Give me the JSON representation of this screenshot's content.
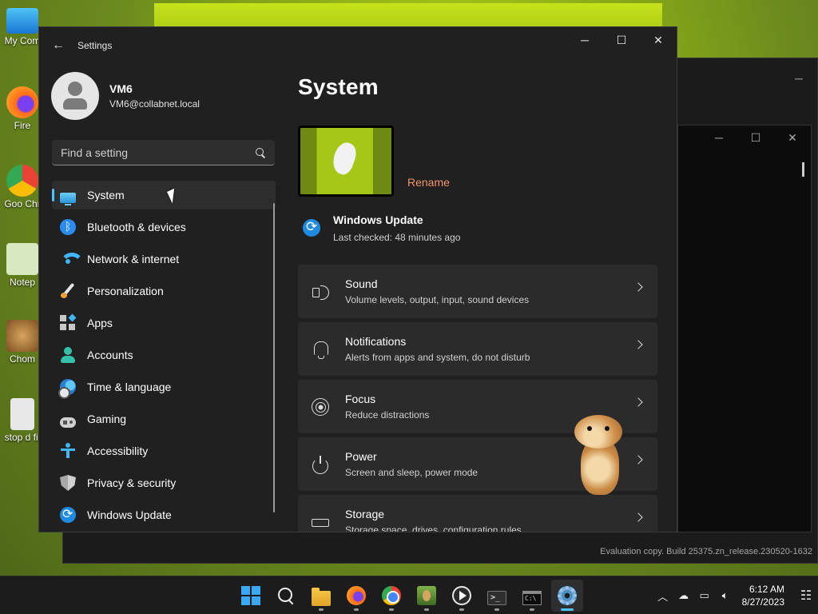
{
  "desktop": {
    "icons": [
      {
        "label": "My Com",
        "icon": "monitor-icon"
      },
      {
        "label": "Fire",
        "icon": "firefox-icon"
      },
      {
        "label": "Goo Chr",
        "icon": "chrome-icon"
      },
      {
        "label": "Notep",
        "icon": "notepad-icon"
      },
      {
        "label": "Chom",
        "icon": "hamster-icon"
      },
      {
        "label": "stop d fil",
        "icon": "file-icon"
      }
    ],
    "build_watermark": "Evaluation copy. Build 25375.zn_release.230520-1632"
  },
  "settings": {
    "app_title": "Settings",
    "back_icon": "back-arrow-icon",
    "window_controls": {
      "minimize": "─",
      "maximize": "☐",
      "close": "✕"
    },
    "profile": {
      "name": "VM6",
      "email": "VM6@collabnet.local"
    },
    "search": {
      "placeholder": "Find a setting"
    },
    "nav": [
      {
        "label": "System",
        "icon": "system-icon",
        "active": true
      },
      {
        "label": "Bluetooth & devices",
        "icon": "bluetooth-icon"
      },
      {
        "label": "Network & internet",
        "icon": "wifi-icon"
      },
      {
        "label": "Personalization",
        "icon": "brush-icon"
      },
      {
        "label": "Apps",
        "icon": "apps-icon"
      },
      {
        "label": "Accounts",
        "icon": "account-icon"
      },
      {
        "label": "Time & language",
        "icon": "clock-globe-icon"
      },
      {
        "label": "Gaming",
        "icon": "gamepad-icon"
      },
      {
        "label": "Accessibility",
        "icon": "accessibility-icon"
      },
      {
        "label": "Privacy & security",
        "icon": "shield-icon"
      },
      {
        "label": "Windows Update",
        "icon": "windows-update-icon"
      }
    ],
    "main": {
      "title": "System",
      "rename_label": "Rename",
      "update": {
        "title": "Windows Update",
        "subtitle": "Last checked: 48 minutes ago"
      },
      "cards": [
        {
          "title": "Sound",
          "desc": "Volume levels, output, input, sound devices",
          "icon": "speaker-icon"
        },
        {
          "title": "Notifications",
          "desc": "Alerts from apps and system, do not disturb",
          "icon": "bell-icon"
        },
        {
          "title": "Focus",
          "desc": "Reduce distractions",
          "icon": "focus-icon"
        },
        {
          "title": "Power",
          "desc": "Screen and sleep, power mode",
          "icon": "power-icon"
        },
        {
          "title": "Storage",
          "desc": "Storage space, drives, configuration rules",
          "icon": "storage-icon"
        }
      ]
    }
  },
  "taskbar": {
    "apps": [
      {
        "name": "Start",
        "icon": "windows-start-icon"
      },
      {
        "name": "Search",
        "icon": "search-icon"
      },
      {
        "name": "File Explorer",
        "icon": "folder-icon",
        "running": true
      },
      {
        "name": "Firefox",
        "icon": "firefox-icon",
        "running": true
      },
      {
        "name": "Google Chrome",
        "icon": "chrome-icon",
        "running": true
      },
      {
        "name": "Game",
        "icon": "game-icon",
        "running": true
      },
      {
        "name": "Media Player",
        "icon": "media-player-icon",
        "running": true
      },
      {
        "name": "Terminal",
        "icon": "terminal-icon",
        "running": true
      },
      {
        "name": "Command Prompt",
        "icon": "cmd-icon",
        "running": true
      },
      {
        "name": "Settings",
        "icon": "settings-gear-icon",
        "running": true,
        "active": true
      }
    ],
    "tray": {
      "time": "6:12 AM",
      "date": "8/27/2023"
    }
  },
  "colors": {
    "accent": "#4cc2ff",
    "rename_link": "#f0956b",
    "window_bg": "#202020",
    "card_bg": "#2b2b2b"
  }
}
